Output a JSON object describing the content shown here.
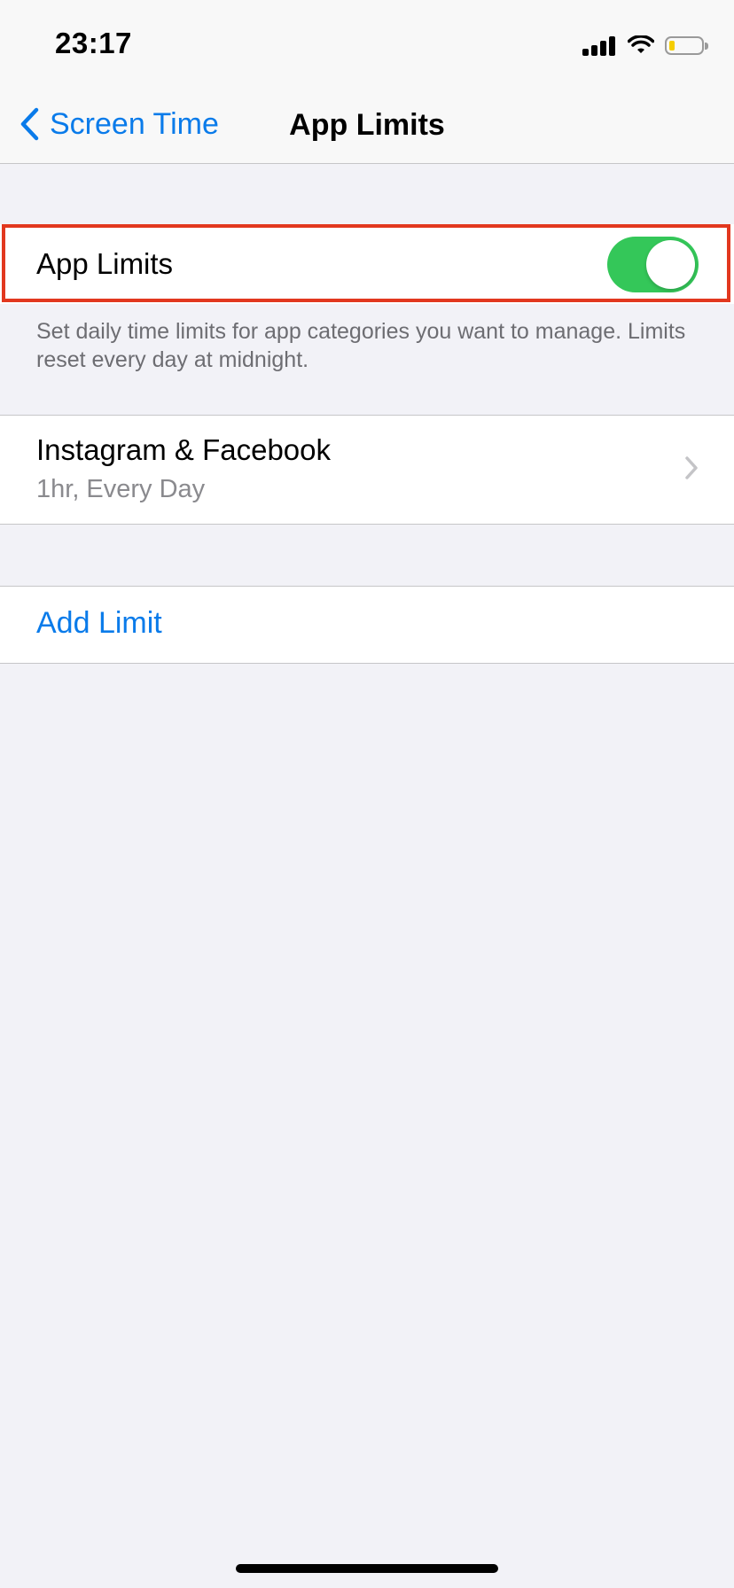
{
  "status_bar": {
    "time": "23:17",
    "icons": [
      "cellular-signal-icon",
      "wifi-icon",
      "battery-icon"
    ]
  },
  "nav": {
    "back_label": "Screen Time",
    "title": "App Limits",
    "accent_color": "#0a7bea"
  },
  "app_limits_toggle": {
    "label": "App Limits",
    "enabled": true,
    "on_color": "#34c759",
    "highlight_color": "#e2381f"
  },
  "footer": {
    "description": "Set daily time limits for app categories you want to manage. Limits reset every day at midnight."
  },
  "limits": [
    {
      "title": "Instagram & Facebook",
      "subtitle": "1hr, Every Day"
    }
  ],
  "add_limit": {
    "label": "Add Limit"
  }
}
